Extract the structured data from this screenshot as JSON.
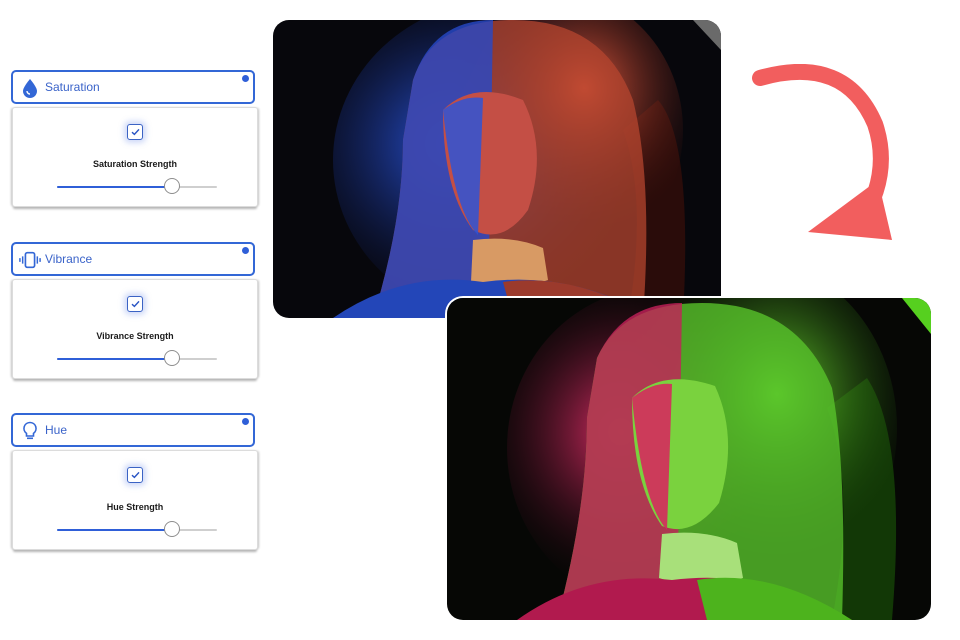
{
  "controls": [
    {
      "label": "Saturation",
      "icon": "water-drop-icon",
      "checked": true,
      "strength_label": "Saturation Strength",
      "value_fraction": 0.72
    },
    {
      "label": "Vibrance",
      "icon": "vibrate-icon",
      "checked": true,
      "strength_label": "Vibrance Strength",
      "value_fraction": 0.72
    },
    {
      "label": "Hue",
      "icon": "lightbulb-icon",
      "checked": true,
      "strength_label": "Hue Strength",
      "value_fraction": 0.72
    }
  ],
  "colors": {
    "accent": "#3367d6",
    "arrow": "#f25e5e",
    "before_tones": [
      "#1f45c9",
      "#d04e3c"
    ],
    "after_tones": [
      "#d8245f",
      "#5fd32a"
    ]
  },
  "images": {
    "before": "photo-before-edit",
    "after": "photo-after-edit"
  },
  "arrow_icon": "curved-arrow-down-icon"
}
